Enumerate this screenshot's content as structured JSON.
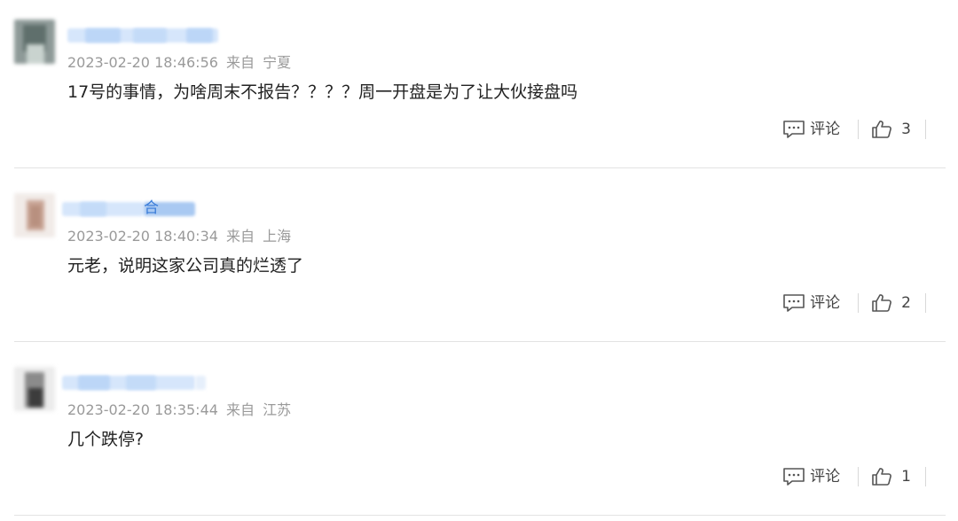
{
  "comments": [
    {
      "timestamp": "2023-02-20 18:46:56",
      "from_label": "来自",
      "location": "宁夏",
      "text": "17号的事情，为啥周末不报告？？？？周一开盘是为了让大伙接盘吗",
      "reply_label": "评论",
      "like_count": "3"
    },
    {
      "username_tail": "合",
      "timestamp": "2023-02-20 18:40:34",
      "from_label": "来自",
      "location": "上海",
      "text": "元老，说明这家公司真的烂透了",
      "reply_label": "评论",
      "like_count": "2"
    },
    {
      "timestamp": "2023-02-20 18:35:44",
      "from_label": "来自",
      "location": "江苏",
      "text": "几个跌停?",
      "reply_label": "评论",
      "like_count": "1"
    }
  ],
  "icons": {
    "reply": "comment-bubble-icon",
    "like": "thumbs-up-icon"
  },
  "colors": {
    "meta_text": "#9a9a9a",
    "body_text": "#222222",
    "username_link": "#3a7cd8",
    "divider": "#e3e3e3"
  }
}
